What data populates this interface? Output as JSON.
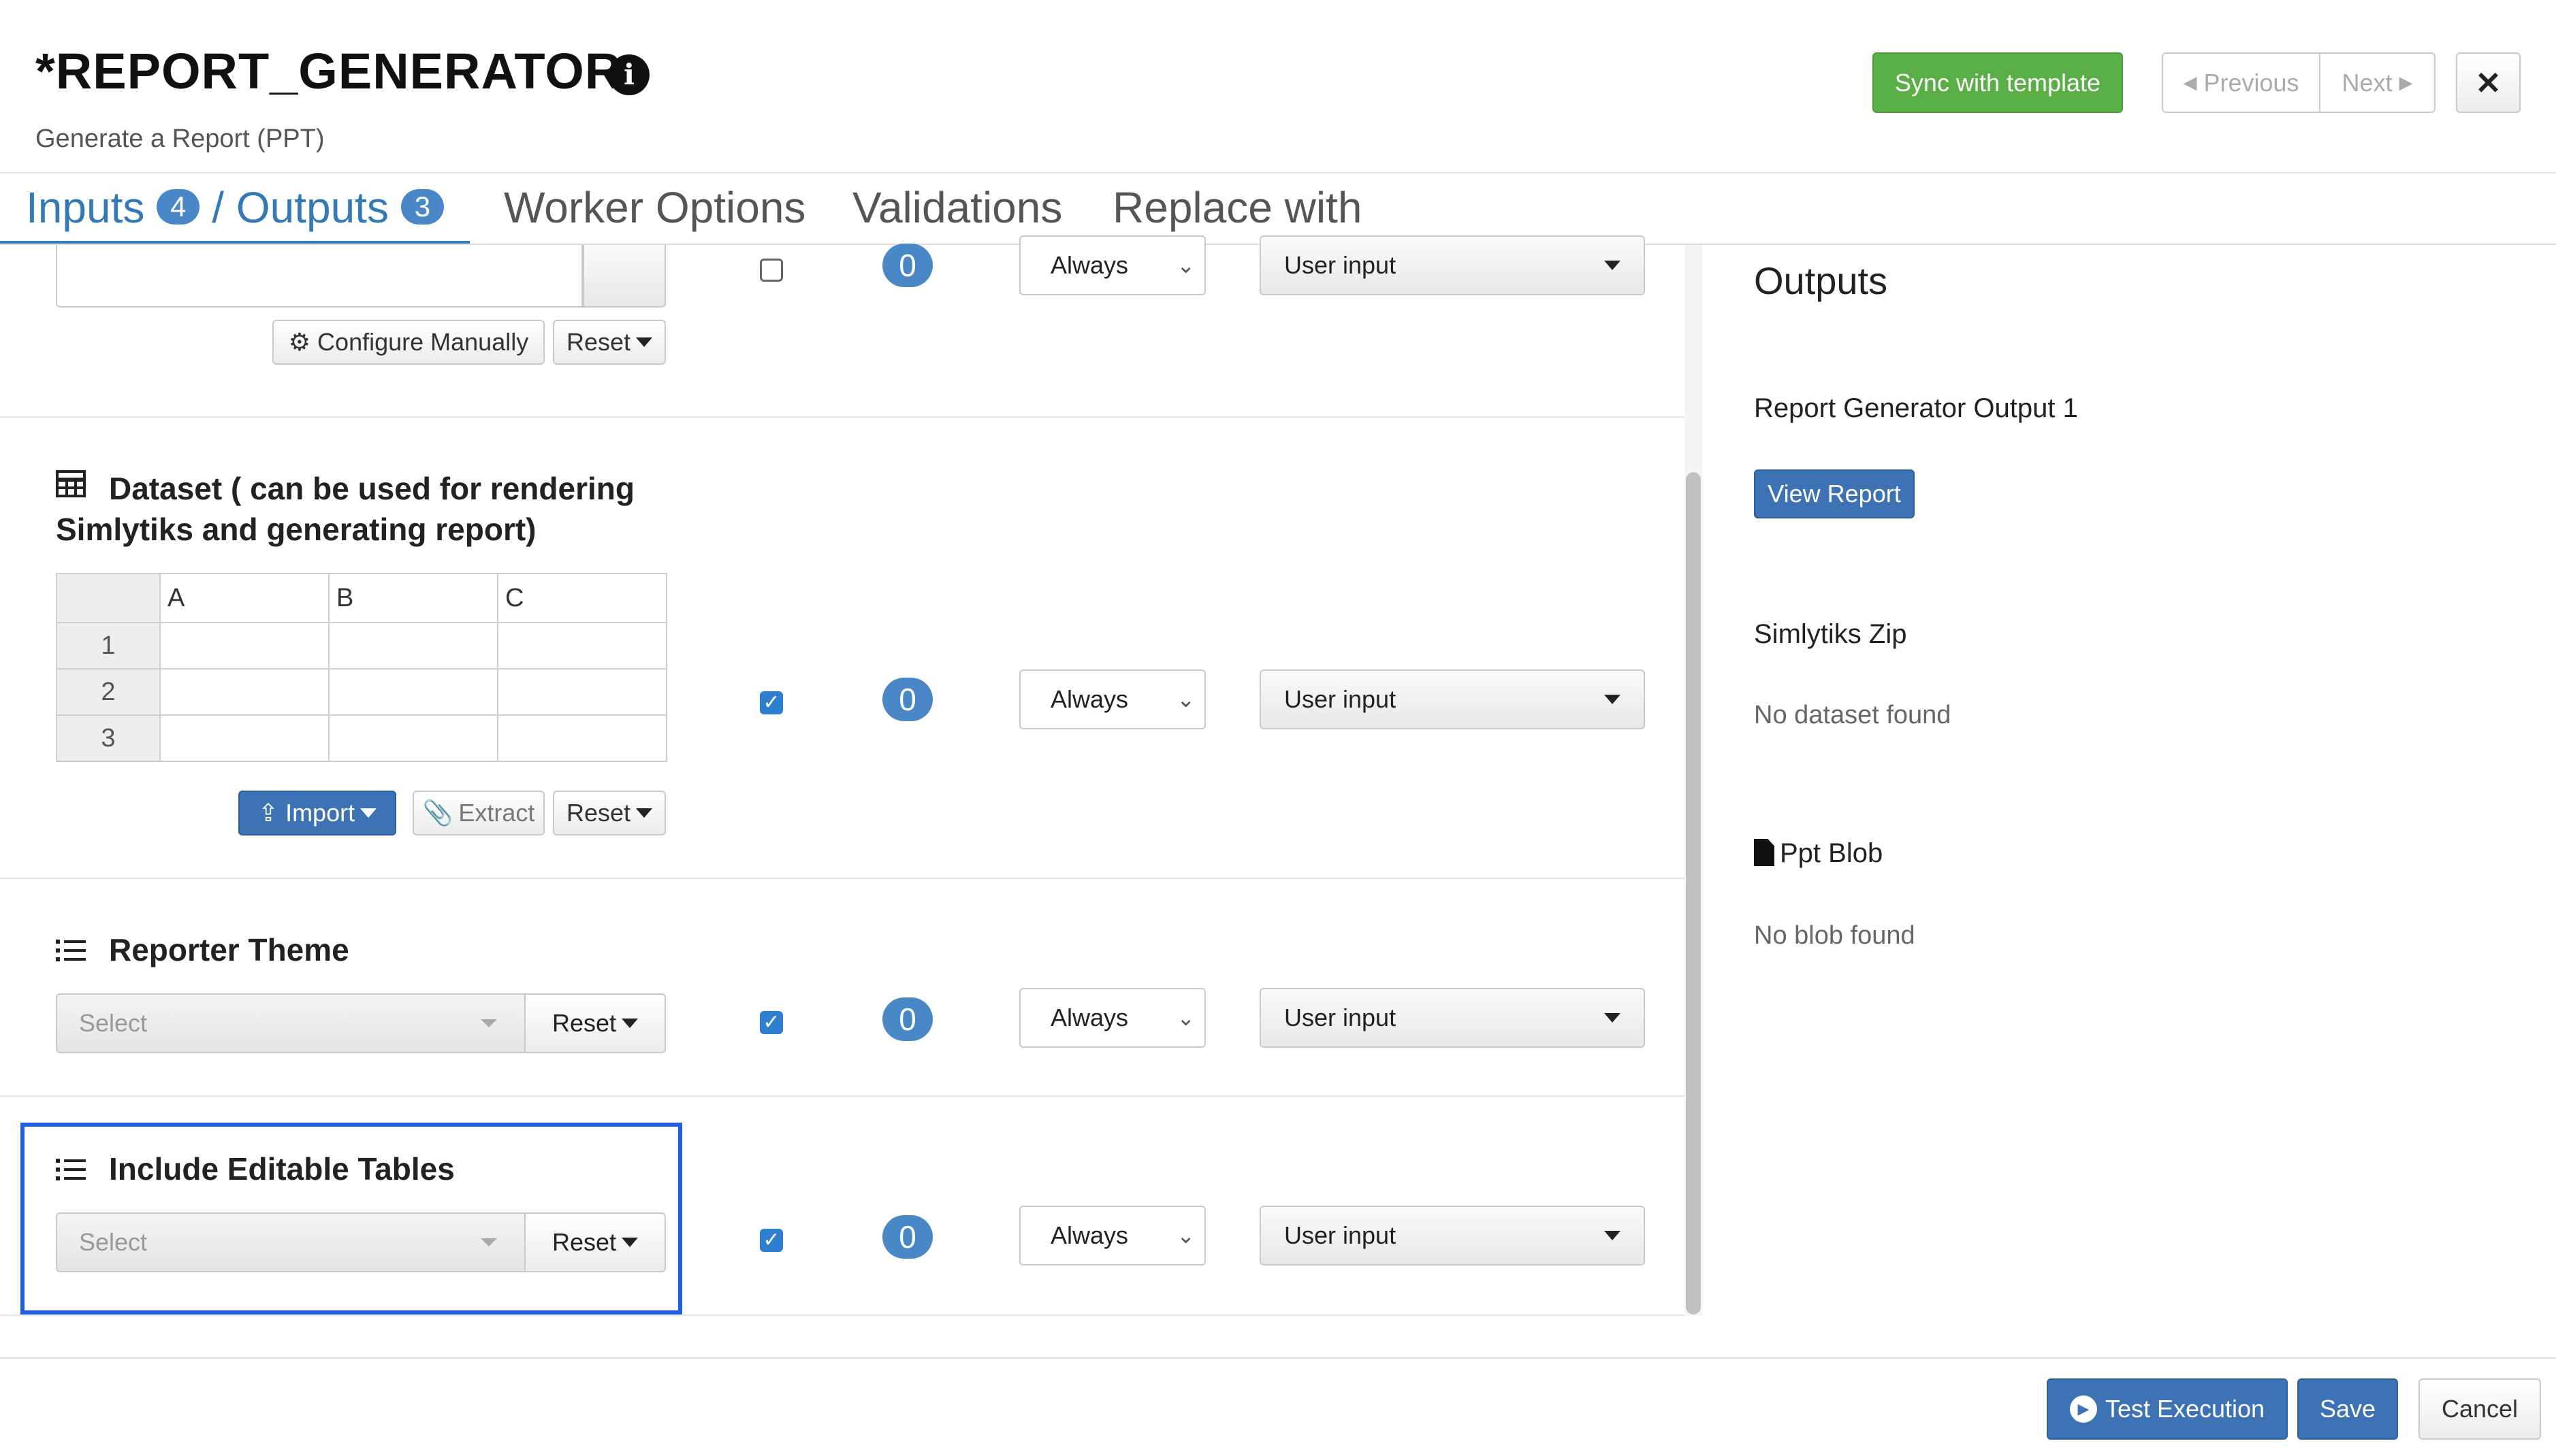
{
  "header": {
    "title": "*REPORT_GENERATOR",
    "info_icon": "info-circle-icon",
    "subtitle": "Generate a Report (PPT)",
    "sync_label": "Sync with template",
    "previous_label": "Previous",
    "next_label": "Next",
    "close_label": "✕"
  },
  "tabs": {
    "inputs_label": "Inputs",
    "inputs_count": "4",
    "outputs_label": "/ Outputs",
    "outputs_count": "3",
    "worker_options": "Worker Options",
    "validations": "Validations",
    "replace_with": "Replace with"
  },
  "rows": {
    "row0": {
      "configure_label": "Configure Manually",
      "reset_label": "Reset",
      "count": "0",
      "always": "Always",
      "source": "User input",
      "checked": false
    },
    "dataset": {
      "title_line1": "Dataset ( can be used for rendering",
      "title_line2": "Simlytiks and generating report)",
      "columns": [
        "A",
        "B",
        "C"
      ],
      "row_labels": [
        "1",
        "2",
        "3"
      ],
      "import_label": "Import",
      "extract_label": "Extract",
      "reset_label": "Reset",
      "count": "0",
      "always": "Always",
      "source": "User input",
      "checked": true
    },
    "theme": {
      "title": "Reporter Theme",
      "placeholder": "Select",
      "reset_label": "Reset",
      "count": "0",
      "always": "Always",
      "source": "User input",
      "checked": true
    },
    "tables": {
      "title": "Include Editable Tables",
      "placeholder": "Select",
      "reset_label": "Reset",
      "count": "0",
      "always": "Always",
      "source": "User input",
      "checked": true
    }
  },
  "outputs": {
    "title": "Outputs",
    "items": [
      {
        "label": "Report Generator Output 1",
        "action": "View Report"
      },
      {
        "label": "Simlytiks Zip",
        "status": "No dataset found"
      },
      {
        "label": "Ppt Blob",
        "status": "No blob found",
        "icon": "file-icon"
      }
    ]
  },
  "footer": {
    "test_label": "Test Execution",
    "save_label": "Save",
    "cancel_label": "Cancel"
  },
  "colors": {
    "accent": "#337ab7",
    "badge": "#4a87c6",
    "success": "#5aae46",
    "highlight": "#1f5fe0"
  }
}
